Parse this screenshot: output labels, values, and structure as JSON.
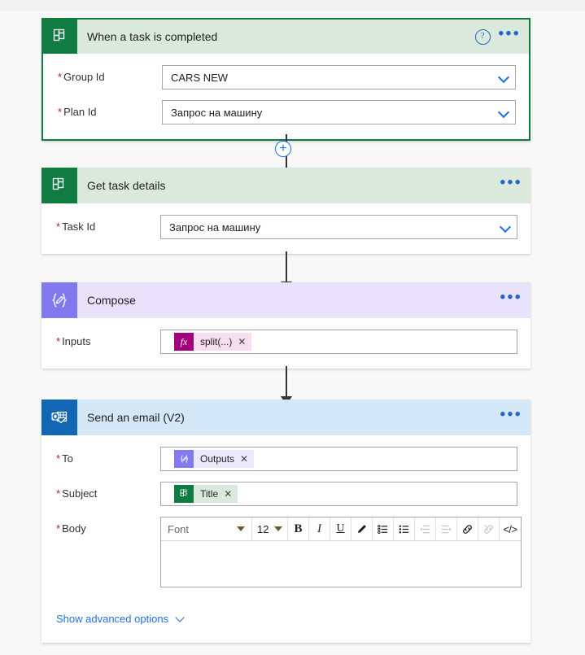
{
  "colors": {
    "page_background": "#f8f8f8",
    "planner_green": "#107c41",
    "compose_purple": "#8378ee",
    "outlook_blue": "#1267b4",
    "link_blue": "#1f6fe5",
    "required_red": "#a4262c",
    "fx_magenta": "#a4007d"
  },
  "cards": [
    {
      "id": "when-a-task-is-completed",
      "title": "When a task is completed",
      "icon": "planner-icon",
      "selected": true,
      "help_icon": "?",
      "menu_icon": "•••",
      "fields": [
        {
          "label": "Group Id",
          "required": "*",
          "value": "CARS NEW",
          "control": "dropdown"
        },
        {
          "label": "Plan Id",
          "required": "*",
          "value": "Запрос на машину",
          "control": "dropdown"
        }
      ]
    },
    {
      "id": "get-task-details",
      "title": "Get task details",
      "icon": "planner-icon",
      "selected": false,
      "menu_icon": "•••",
      "fields": [
        {
          "label": "Task Id",
          "required": "*",
          "value": "Запрос на машину",
          "control": "dropdown"
        }
      ]
    },
    {
      "id": "compose",
      "title": "Compose",
      "icon": "compose-icon",
      "selected": false,
      "menu_icon": "•••",
      "fields": [
        {
          "label": "Inputs",
          "required": "*",
          "control": "token",
          "token": {
            "badge": "fx",
            "text": "split(...)",
            "close": "✕"
          }
        }
      ]
    },
    {
      "id": "send-an-email-v2",
      "title": "Send an email (V2)",
      "icon": "outlook-icon",
      "selected": false,
      "menu_icon": "•••",
      "fields": [
        {
          "label": "To",
          "required": "*",
          "control": "token",
          "token": {
            "badge": "compose-icon",
            "text": "Outputs",
            "close": "✕"
          }
        },
        {
          "label": "Subject",
          "required": "*",
          "control": "token",
          "token": {
            "badge": "planner-icon",
            "text": "Title",
            "close": "✕"
          }
        },
        {
          "label": "Body",
          "required": "*",
          "control": "richtext"
        }
      ],
      "advanced_options_label": "Show advanced options"
    }
  ],
  "editor_toolbar": {
    "font_name": "Font",
    "font_size": "12",
    "buttons": [
      {
        "name": "bold-button",
        "glyph": "B",
        "enabled": true
      },
      {
        "name": "italic-button",
        "glyph": "I",
        "enabled": true
      },
      {
        "name": "underline-button",
        "glyph": "U",
        "enabled": true
      },
      {
        "name": "highlighter-button",
        "glyph": "✏",
        "enabled": true
      },
      {
        "name": "bulleted-list-button",
        "glyph": "☷",
        "enabled": true
      },
      {
        "name": "numbered-list-button",
        "glyph": "☰",
        "enabled": true
      },
      {
        "name": "decrease-indent-button",
        "glyph": "⇤",
        "enabled": false
      },
      {
        "name": "increase-indent-button",
        "glyph": "⇥",
        "enabled": false
      },
      {
        "name": "insert-link-button",
        "glyph": "🔗",
        "enabled": true
      },
      {
        "name": "remove-link-button",
        "glyph": "🔗",
        "enabled": false
      },
      {
        "name": "code-view-button",
        "glyph": "</>",
        "enabled": true
      }
    ]
  },
  "connectors": [
    {
      "add_step_label": "+",
      "has_add_button": true
    },
    {
      "has_add_button": false
    },
    {
      "has_add_button": false
    }
  ]
}
